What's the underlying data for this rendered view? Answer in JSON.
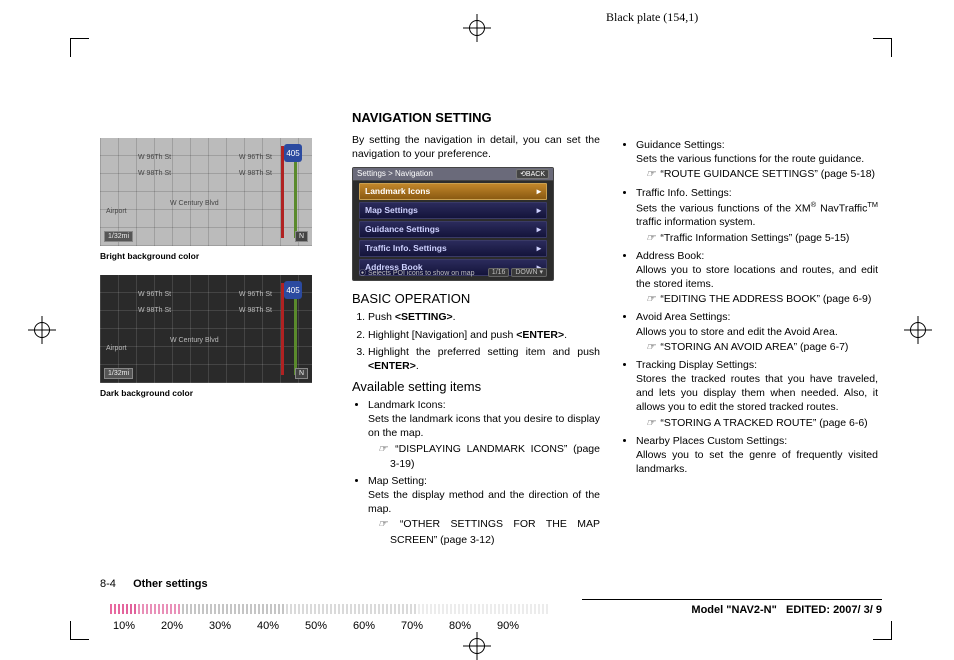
{
  "black_plate": "Black plate (154,1)",
  "section_title": "NAVIGATION SETTING",
  "intro": "By setting the navigation in detail, you can set the navigation to your preference.",
  "left": {
    "bright_caption": "Bright background color",
    "dark_caption": "Dark background color",
    "hwy": "405",
    "street1": "W 96Th St",
    "street2": "W 98Th St",
    "street3": "W Century Blvd",
    "airport": "Airport",
    "scale": "1/32mi",
    "compass": "N"
  },
  "screenshot": {
    "breadcrumb": "Settings > Navigation",
    "back": "⟲BACK",
    "items": [
      "Landmark Icons",
      "Map Settings",
      "Guidance Settings",
      "Traffic Info. Settings",
      "Address Book"
    ],
    "hint": "⦿ Selects POI icons to show on map",
    "page": "1/16",
    "down": "DOWN ▾"
  },
  "basic_operation": {
    "title": "BASIC OPERATION",
    "steps": [
      {
        "pre": "Push ",
        "btn": "<SETTING>",
        "post": "."
      },
      {
        "pre": "Highlight [Navigation] and push ",
        "btn": "<ENTER>",
        "post": "."
      },
      {
        "pre": "Highlight the preferred setting item and push ",
        "btn": "<ENTER>",
        "post": "."
      }
    ]
  },
  "available": {
    "title": "Available setting items",
    "left_items": [
      {
        "name": "Landmark Icons:",
        "desc": "Sets the landmark icons that you desire to display on the map.",
        "ref": "“DISPLAYING LANDMARK ICONS” (page 3-19)"
      },
      {
        "name": "Map Setting:",
        "desc": "Sets the display method and the direction of the map.",
        "ref": "“OTHER SETTINGS FOR THE MAP SCREEN” (page 3-12)"
      }
    ],
    "right_items": [
      {
        "name": "Guidance Settings:",
        "desc": "Sets the various functions for the route guidance.",
        "ref": "“ROUTE GUIDANCE SETTINGS” (page 5-18)"
      },
      {
        "name": "Traffic Info. Settings:",
        "desc_html": "Sets the various functions of the XM<sup>®</sup> NavTraffic<sup>TM</sup> traffic information system.",
        "ref": "“Traffic Information Settings” (page 5-15)"
      },
      {
        "name": "Address Book:",
        "desc": "Allows you to store locations and routes, and edit the stored items.",
        "ref": "“EDITING THE ADDRESS BOOK” (page 6-9)"
      },
      {
        "name": "Avoid Area Settings:",
        "desc": "Allows you to store and edit the Avoid Area.",
        "ref": "“STORING AN AVOID AREA” (page 6-7)"
      },
      {
        "name": "Tracking Display Settings:",
        "desc": "Stores the tracked routes that you have traveled, and lets you display them when needed. Also, it allows you to edit the stored tracked routes.",
        "ref": "“STORING A TRACKED ROUTE” (page 6-6)"
      },
      {
        "name": "Nearby Places Custom Settings:",
        "desc": "Allows you to set the genre of frequently visited landmarks.",
        "ref": ""
      }
    ]
  },
  "footer": {
    "page_num": "8-4",
    "page_label": "Other settings"
  },
  "model_line": {
    "prefix": "Model ",
    "model": "\"NAV2-N\"",
    "edited_label": "EDITED: ",
    "edited_date": "2007/ 3/ 9"
  },
  "percent": [
    "10%",
    "20%",
    "30%",
    "40%",
    "50%",
    "60%",
    "70%",
    "80%",
    "90%"
  ]
}
